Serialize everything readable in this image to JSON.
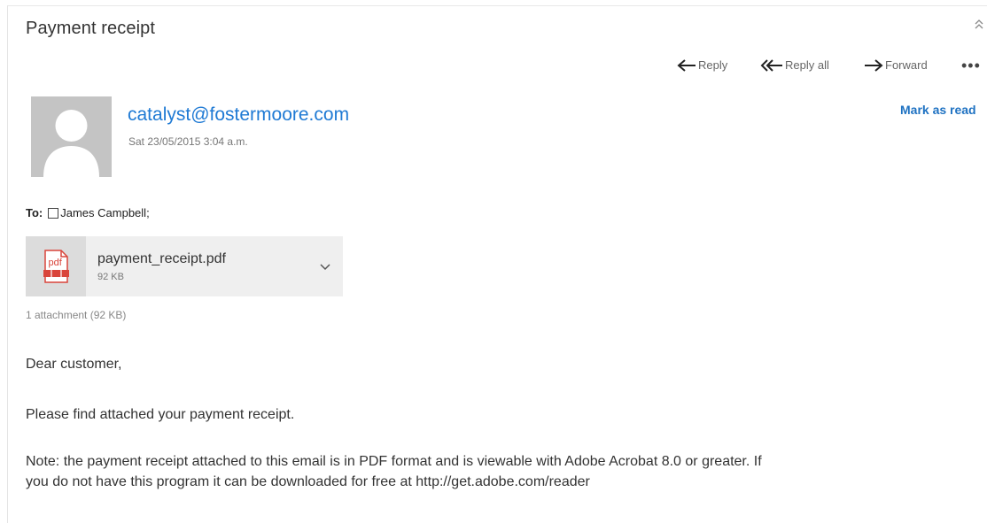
{
  "message": {
    "subject": "Payment receipt",
    "sender_email": "catalyst@fostermoore.com",
    "sent_date": "Sat 23/05/2015 3:04 a.m.",
    "mark_as_read": "Mark as read"
  },
  "toolbar": {
    "reply": "Reply",
    "reply_all": "Reply all",
    "forward": "Forward",
    "more": "•••"
  },
  "recipients": {
    "to_label": "To:",
    "to": "James Campbell;"
  },
  "attachment": {
    "icon": "pdf-icon",
    "file_name": "payment_receipt.pdf",
    "file_size": "92 KB",
    "summary": "1 attachment (92 KB)"
  },
  "body": {
    "greeting": "Dear customer,",
    "line1": "Please find attached your payment receipt.",
    "line2a": "Note: the payment receipt attached to this email is in PDF format and is viewable with Adobe Acrobat 8.0 or greater. If",
    "line2b": "you do not have this program it can be downloaded for free at http://get.adobe.com/reader"
  },
  "colors": {
    "link_blue": "#1f7ad4",
    "pdf_red": "#d9453b"
  }
}
